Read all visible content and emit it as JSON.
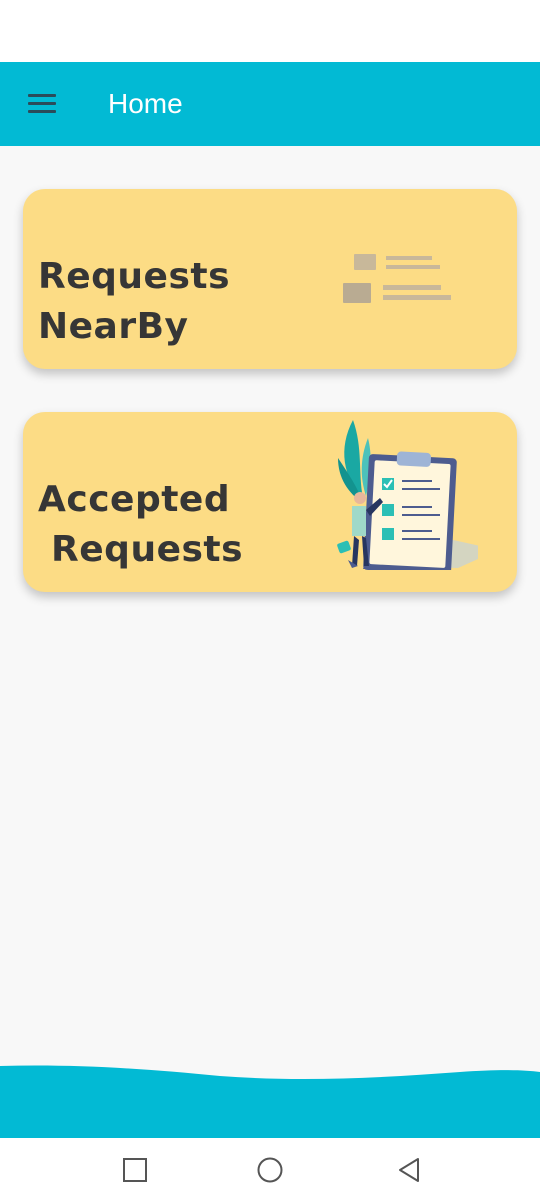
{
  "app_bar": {
    "title": "Home",
    "menu_icon": "hamburger-menu-icon",
    "background_color": "#02bad4"
  },
  "cards": [
    {
      "title_lines": [
        "Requests",
        "NearBy"
      ],
      "icon": "list-illustration-icon",
      "background_color": "#fcdc85"
    },
    {
      "title_lines": [
        "Accepted",
        " Requests"
      ],
      "icon": "checklist-clipboard-illustration",
      "background_color": "#fcdc85"
    }
  ],
  "nav_bar": {
    "buttons": [
      "recent-apps-square-icon",
      "home-circle-icon",
      "back-triangle-icon"
    ]
  },
  "colors": {
    "accent": "#02bad4",
    "card": "#fcdc85",
    "text_dark": "#363636",
    "background": "#f8f8f8"
  }
}
